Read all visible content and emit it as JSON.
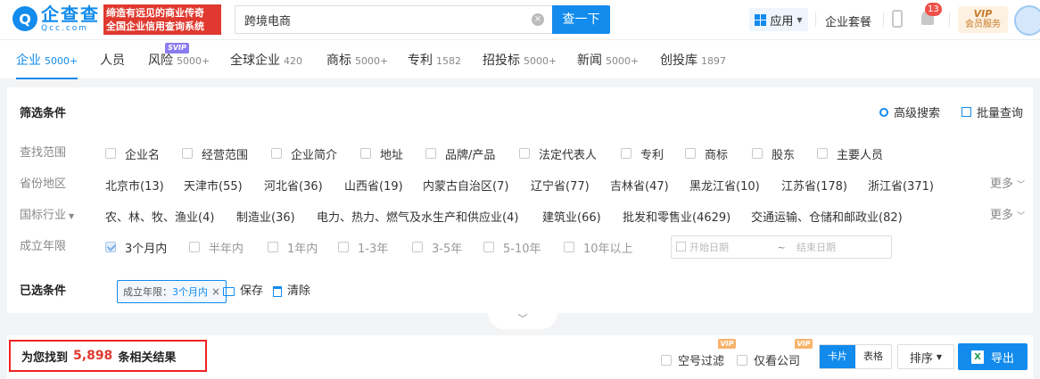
{
  "header": {
    "logo_name": "企查查",
    "logo_domain": "Qcc.com",
    "logo_mark": "Q",
    "slogan_line1": "缔造有远见的商业传奇",
    "slogan_line2": "全国企业信用查询系统",
    "search_value": "跨境电商",
    "search_button": "查一下",
    "app_button": "应用",
    "suite_link": "企业套餐",
    "notification_count": "13",
    "vip_label": "VIP",
    "vip_sub": "会员服务"
  },
  "tabs": [
    {
      "label": "企业",
      "count": "5000+"
    },
    {
      "label": "人员",
      "count": ""
    },
    {
      "label": "风险",
      "count": "5000+"
    },
    {
      "label": "全球企业",
      "count": "420"
    },
    {
      "label": "商标",
      "count": "5000+"
    },
    {
      "label": "专利",
      "count": "1582"
    },
    {
      "label": "招投标",
      "count": "5000+"
    },
    {
      "label": "新闻",
      "count": "5000+"
    },
    {
      "label": "创投库",
      "count": "1897"
    }
  ],
  "svip_tag": "SVIP",
  "filters": {
    "title": "筛选条件",
    "advanced_search": "高级搜索",
    "batch_query": "批量查询",
    "scope": {
      "label": "查找范围",
      "options": [
        "企业名",
        "经营范围",
        "企业简介",
        "地址",
        "品牌/产品",
        "法定代表人",
        "专利",
        "商标",
        "股东",
        "主要人员"
      ]
    },
    "region": {
      "label": "省份地区",
      "options": [
        "北京市(13)",
        "天津市(55)",
        "河北省(36)",
        "山西省(19)",
        "内蒙古自治区(7)",
        "辽宁省(77)",
        "吉林省(47)",
        "黑龙江省(10)",
        "江苏省(178)",
        "浙江省(371)"
      ],
      "more": "更多"
    },
    "industry": {
      "label": "国标行业",
      "options": [
        "农、林、牧、渔业(4)",
        "制造业(36)",
        "电力、热力、燃气及水生产和供应业(4)",
        "建筑业(66)",
        "批发和零售业(4629)",
        "交通运输、仓储和邮政业(82)"
      ],
      "more": "更多"
    },
    "founded": {
      "label": "成立年限",
      "options": [
        "3个月内",
        "半年内",
        "1年内",
        "1-3年",
        "3-5年",
        "5-10年",
        "10年以上"
      ],
      "start_placeholder": "开始日期",
      "tilde": "~",
      "end_placeholder": "结束日期"
    },
    "selected": {
      "label": "已选条件",
      "chip_key": "成立年限：",
      "chip_value": "3个月内",
      "chip_close": "×",
      "save": "保存",
      "clear": "清除"
    }
  },
  "results": {
    "prefix": "为您找到",
    "count": "5,898",
    "suffix": "条相关结果",
    "filter_empty": "空号过滤",
    "filter_view": "仅看公司",
    "vip_tag": "VIP",
    "view_card": "卡片",
    "view_table": "表格",
    "sort": "排序",
    "export": "导出",
    "excel_glyph": "X"
  },
  "colors": {
    "brand": "#128bed",
    "slogan_bg": "#e0392f",
    "highlight_border": "#ee2222",
    "count_red": "#e0392f"
  }
}
